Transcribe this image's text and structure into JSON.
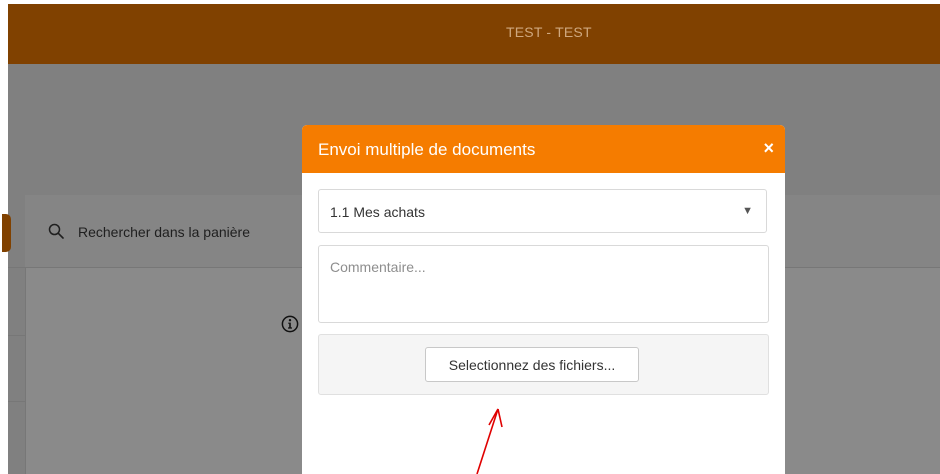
{
  "header": {
    "title": "TEST - TEST"
  },
  "background": {
    "search_text": "Rechercher dans la panière",
    "search_icon": "search-icon",
    "info_icon": "info-icon"
  },
  "modal": {
    "title": "Envoi multiple de documents",
    "close_symbol": "×",
    "category_select": {
      "selected": "1.1 Mes achats",
      "arrow": "▼"
    },
    "comment": {
      "placeholder": "Commentaire...",
      "value": ""
    },
    "file_button_label": "Selectionnez des fichiers..."
  },
  "colors": {
    "header_brand": "#804100",
    "modal_header": "#f57c00",
    "overlay": "#808080",
    "annotation_arrow": "#e00000"
  }
}
